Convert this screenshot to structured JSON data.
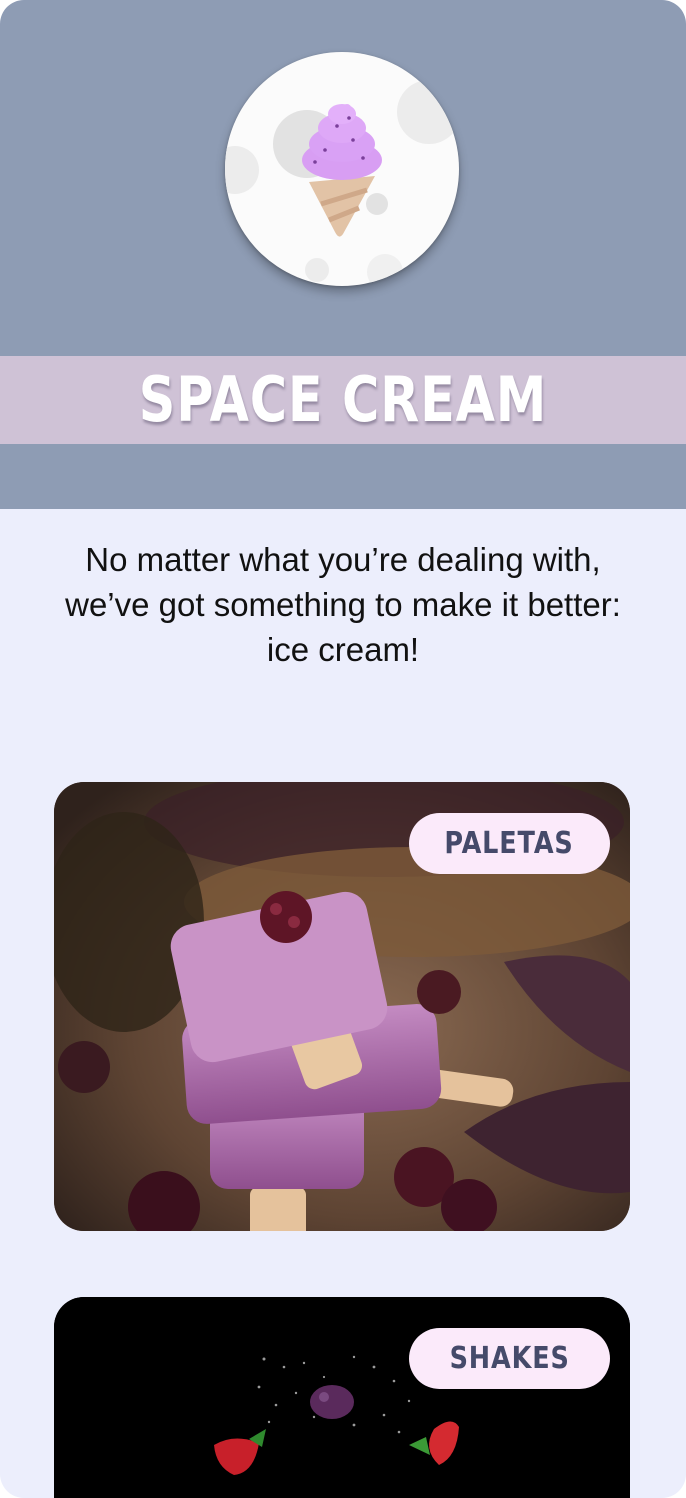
{
  "brand": {
    "name": "SPACE CREAM",
    "logo_icon": "ice-cream-cone-icon"
  },
  "intro": {
    "tagline": "No matter what you’re dealing with, we’ve got something to make it better: ice cream!"
  },
  "categories": [
    {
      "label": "PALETAS",
      "image": "purple-paletas-photo"
    },
    {
      "label": "SHAKES",
      "image": "berries-splash-photo"
    }
  ],
  "colors": {
    "hero_background": "#8e9cb4",
    "title_band": "#cfc2d6",
    "page_background": "#eceefc",
    "pill_background": "#fbeafa",
    "pill_text": "#454a6a"
  }
}
